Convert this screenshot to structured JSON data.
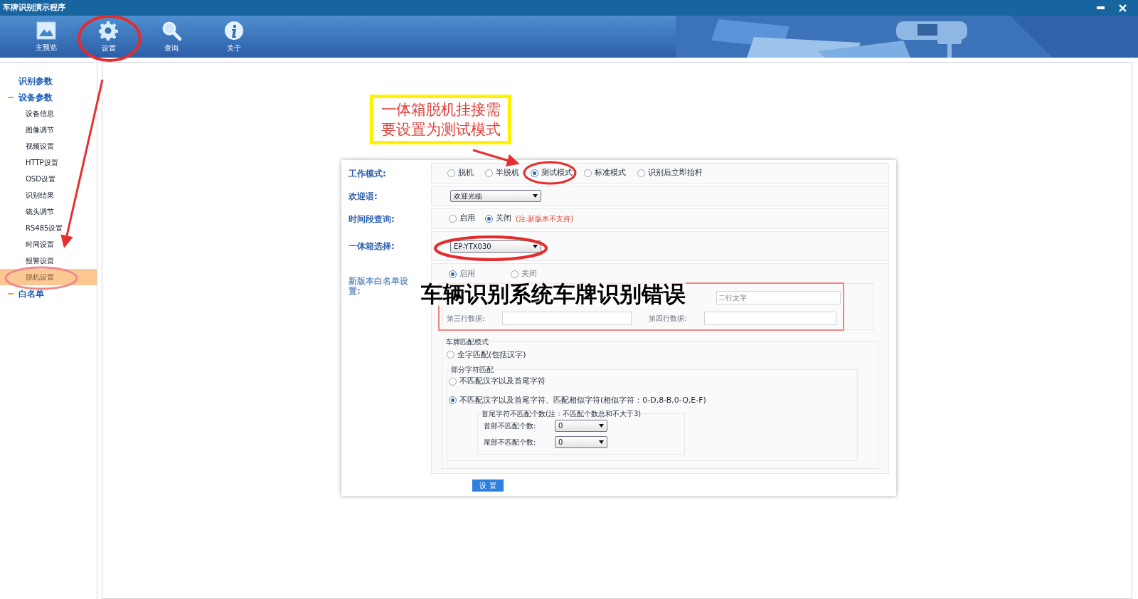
{
  "window": {
    "title": "车牌识别演示程序"
  },
  "toolbar": [
    {
      "label": "主预览",
      "kind": "picture"
    },
    {
      "label": "设置",
      "kind": "gear"
    },
    {
      "label": "查询",
      "kind": "search"
    },
    {
      "label": "关于",
      "kind": "info"
    }
  ],
  "sidebar": {
    "items": [
      {
        "label": "识别参数",
        "expanded": false
      },
      {
        "label": "设备参数",
        "expanded": true,
        "children": [
          {
            "label": "设备信息",
            "selected": false
          },
          {
            "label": "图像调节",
            "selected": false
          },
          {
            "label": "视频设置",
            "selected": false
          },
          {
            "label": "HTTP设置",
            "selected": false
          },
          {
            "label": "OSD设置",
            "selected": false
          },
          {
            "label": "识别结果",
            "selected": false
          },
          {
            "label": "镜头调节",
            "selected": false
          },
          {
            "label": "RS485设置",
            "selected": false
          },
          {
            "label": "时间设置",
            "selected": false
          },
          {
            "label": "报警设置",
            "selected": false
          },
          {
            "label": "脱机设置",
            "selected": true
          }
        ]
      },
      {
        "label": "白名单",
        "expanded": true
      }
    ]
  },
  "callout": {
    "lines": [
      "一体箱脱机挂接需",
      "要设置为测试模式"
    ]
  },
  "form": {
    "work_mode": {
      "label": "工作模式:",
      "options": [
        {
          "label": "脱机",
          "selected": false
        },
        {
          "label": "半脱机",
          "selected": false
        },
        {
          "label": "测试模式",
          "selected": true
        },
        {
          "label": "标准模式",
          "selected": false
        },
        {
          "label": "识别后立即抬杆",
          "selected": false
        }
      ]
    },
    "welcome": {
      "label": "欢迎语:",
      "value": "欢迎光临"
    },
    "time_query": {
      "label": "时间段查询:",
      "options": [
        {
          "label": "启用",
          "selected": false
        },
        {
          "label": "关闭",
          "selected": true
        }
      ],
      "note": "(注:新版本不支持)"
    },
    "box_select": {
      "label": "一体箱选择:",
      "value": "EP-YTX030"
    },
    "whitelist": {
      "label": "新版本白名单设置:",
      "options": [
        {
          "label": "启用",
          "selected": true
        },
        {
          "label": "关闭",
          "selected": false
        }
      ],
      "row_2_placeholder": "二行文字",
      "row_3_label": "第三行数据:",
      "row_4_label": "第四行数据:"
    },
    "match_mode": {
      "legend": "车牌匹配模式",
      "full": {
        "label": "全字匹配(包括汉字)",
        "selected": false
      },
      "partial": {
        "legend": "部分字符匹配",
        "options": [
          {
            "label": "不匹配汉字以及首尾字符",
            "selected": false
          },
          {
            "label": "不匹配汉字以及首尾字符、匹配相似字符(相似字符：0-D,8-B,0-Q,E-F)",
            "selected": true
          }
        ],
        "count": {
          "legend": "首尾字符不匹配个数(注：不匹配个数总和不大于3)",
          "rows": [
            {
              "label": "首部不匹配个数:",
              "value": "0"
            },
            {
              "label": "尾部不匹配个数:",
              "value": "0"
            }
          ]
        }
      }
    },
    "submit": "设 置"
  },
  "overlay_title": "车辆识别系统车牌识别错误"
}
